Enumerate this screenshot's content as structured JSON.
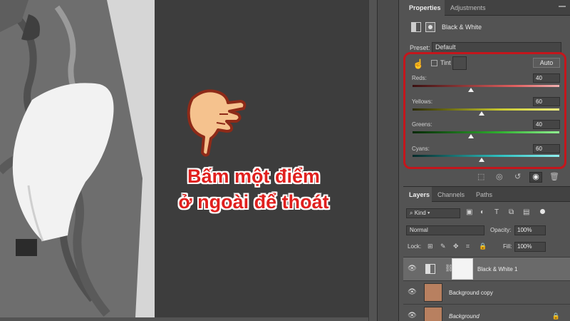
{
  "overlay": {
    "caption_line1": "Bấm một điểm",
    "caption_line2": "ở ngoài để thoát",
    "caption_color": "#e0201e"
  },
  "properties_panel": {
    "tabs": [
      "Properties",
      "Adjustments"
    ],
    "adjustment_title": "Black & White",
    "preset_label": "Preset:",
    "preset_value": "Default",
    "tint_label": "Tint",
    "auto_label": "Auto",
    "sliders": [
      {
        "label": "Reds:",
        "value": "40",
        "track": "reds",
        "level": 0.4
      },
      {
        "label": "Yellows:",
        "value": "60",
        "track": "yellows",
        "level": 0.47
      },
      {
        "label": "Greens:",
        "value": "40",
        "track": "greens",
        "level": 0.4
      },
      {
        "label": "Cyans:",
        "value": "60",
        "track": "cyans",
        "level": 0.47
      }
    ],
    "highlight_color": "#c4161c"
  },
  "layers_panel": {
    "tabs": [
      "Layers",
      "Channels",
      "Paths"
    ],
    "kind_filter": "Kind",
    "blend_mode": "Normal",
    "opacity_label": "Opacity:",
    "opacity_value": "100%",
    "lock_label": "Lock:",
    "fill_label": "Fill:",
    "fill_value": "100%",
    "layers": [
      {
        "name": "Black & White 1",
        "type": "adjustment",
        "selected": true
      },
      {
        "name": "Background copy",
        "type": "image",
        "selected": false
      },
      {
        "name": "Background",
        "type": "image",
        "selected": false,
        "locked": true
      }
    ]
  }
}
